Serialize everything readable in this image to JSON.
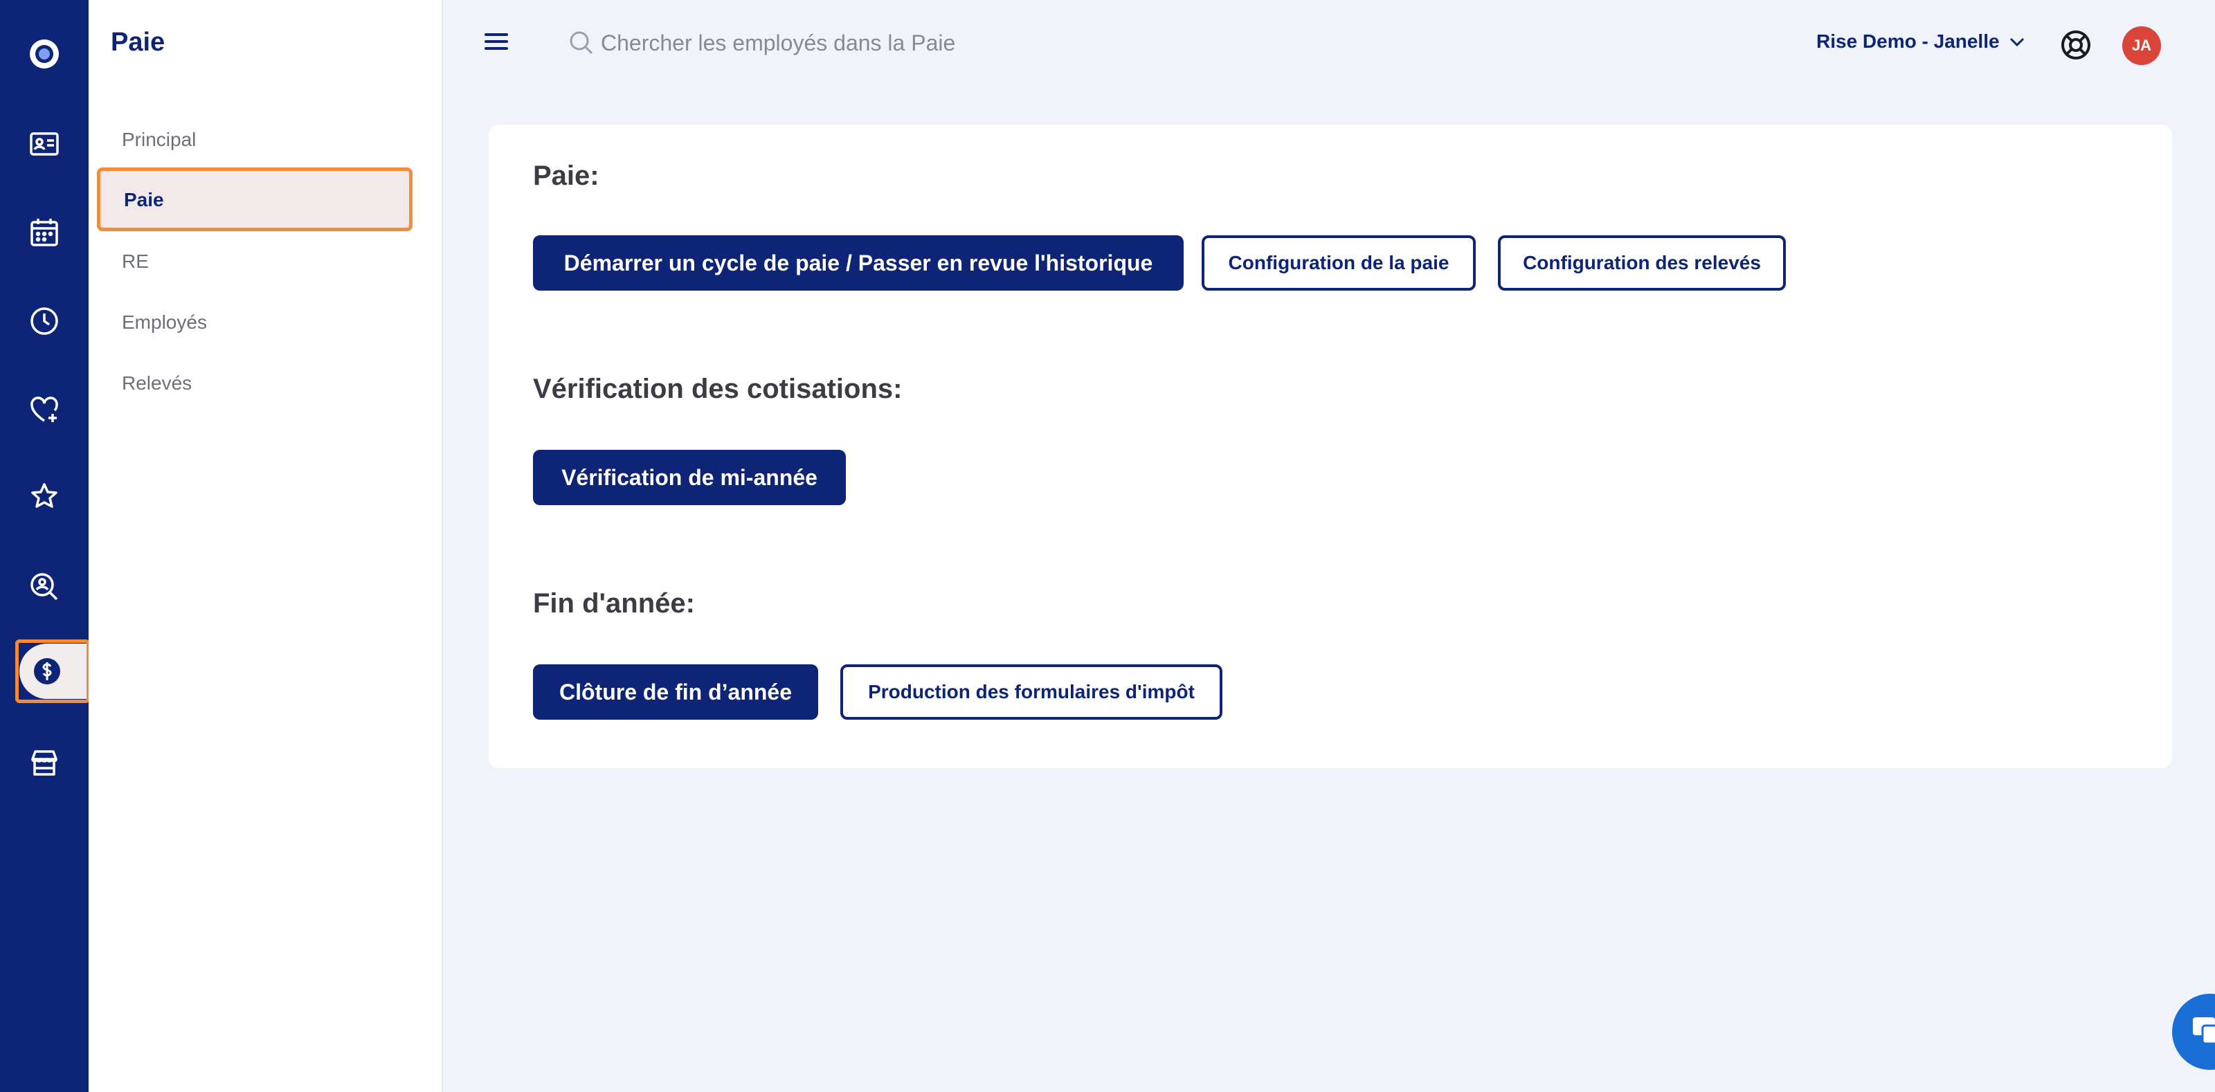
{
  "rail": {
    "items": [
      {
        "name": "rail-employee-card-icon"
      },
      {
        "name": "rail-calendar-icon"
      },
      {
        "name": "rail-clock-icon"
      },
      {
        "name": "rail-heart-plus-icon"
      },
      {
        "name": "rail-star-icon"
      },
      {
        "name": "rail-search-person-icon"
      },
      {
        "name": "rail-dollar-icon",
        "active": true
      },
      {
        "name": "rail-store-icon"
      }
    ]
  },
  "sidebar": {
    "title": "Paie",
    "items": [
      {
        "label": "Principal"
      },
      {
        "label": "Paie",
        "active": true
      },
      {
        "label": "RE"
      },
      {
        "label": "Employés"
      },
      {
        "label": "Relevés"
      }
    ]
  },
  "header": {
    "search_placeholder": "Chercher les employés dans la Paie",
    "account": "Rise Demo - Janelle",
    "avatar_initials": "JA"
  },
  "main": {
    "payroll": {
      "title": "Paie:",
      "start_cycle": "Démarrer un cycle de paie / Passer en revue l'historique",
      "config_payroll": "Configuration de la paie",
      "config_statements": "Configuration des relevés"
    },
    "contributions": {
      "title": "Vérification des cotisations:",
      "midyear": "Vérification de mi-année"
    },
    "year_end": {
      "title": "Fin d'année:",
      "closing": "Clôture de fin d’année",
      "tax_forms": "Production des formulaires d'impôt"
    }
  },
  "colors": {
    "brand": "#0e2477",
    "highlight": "#f28b3a",
    "avatar": "#d9443b",
    "chat": "#1a6fd6"
  }
}
